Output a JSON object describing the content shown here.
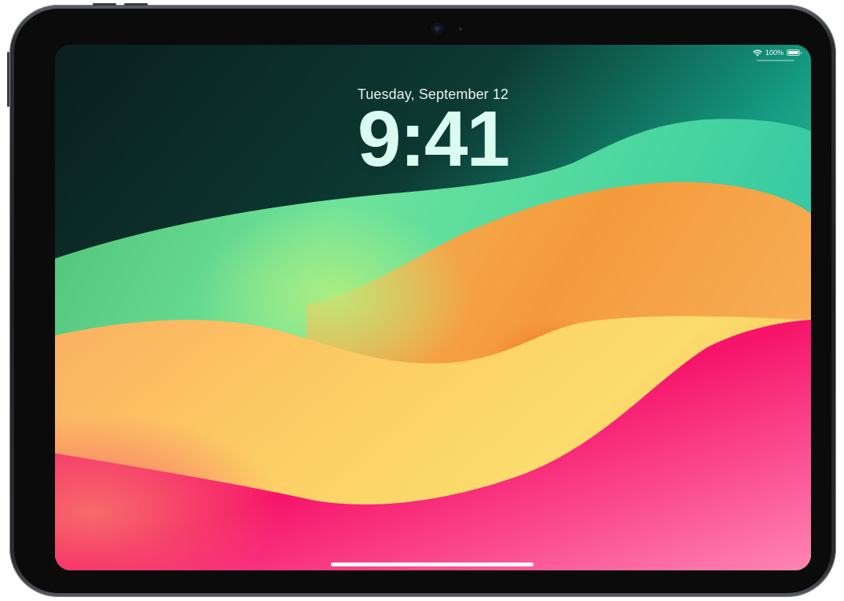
{
  "status_bar": {
    "wifi_icon": "wifi-icon",
    "battery_percent": "100%",
    "battery_level": 1.0
  },
  "lock_screen": {
    "date": "Tuesday, September 12",
    "time": "9:41"
  },
  "colors": {
    "wallpaper_dark_teal": "#0d2a26",
    "wallpaper_green": "#6fe08a",
    "wallpaper_orange": "#f7a046",
    "wallpaper_yellow": "#fad765",
    "wallpaper_pink": "#f5196b",
    "clock_text": "#d9fbf0"
  }
}
